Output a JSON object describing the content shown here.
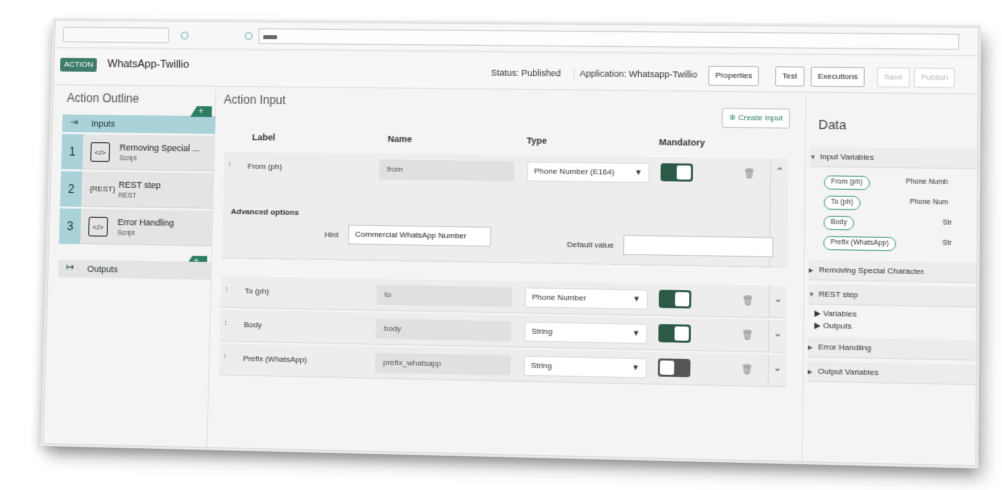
{
  "header": {
    "badge": "ACTION",
    "title": "WhatsApp-Twillio",
    "status": "Status: Published",
    "application": "Application: Whatsapp-Twillio",
    "buttons": {
      "properties": "Properties",
      "test": "Test",
      "executions": "Executions",
      "save": "Save",
      "publish": "Publish"
    }
  },
  "outline": {
    "title": "Action Outline",
    "inputs_label": "Inputs",
    "outputs_label": "Outputs",
    "plus": "+",
    "steps": [
      {
        "num": "1",
        "name": "Removing Special ...",
        "type": "Script",
        "icon": "script-icon"
      },
      {
        "num": "2",
        "name": "REST step",
        "type": "REST",
        "icon": "rest-icon",
        "icon_text": "{REST}"
      },
      {
        "num": "3",
        "name": "Error Handling",
        "type": "Script",
        "icon": "script-icon"
      }
    ]
  },
  "action_input": {
    "title": "Action Input",
    "create_label": "Create Input",
    "columns": {
      "label": "Label",
      "name": "Name",
      "type": "Type",
      "mandatory": "Mandatory"
    },
    "advanced": {
      "title": "Advanced options",
      "hint_label": "Hint",
      "hint_value": "Commercial WhatsApp Number",
      "default_label": "Default value",
      "default_value": ""
    },
    "rows": [
      {
        "label": "From (ph)",
        "name": "from",
        "type": "Phone Number (E164)",
        "mandatory": true,
        "expanded": true
      },
      {
        "label": "To (ph)",
        "name": "to",
        "type": "Phone Number",
        "mandatory": true,
        "expanded": false
      },
      {
        "label": "Body",
        "name": "body",
        "type": "String",
        "mandatory": true,
        "expanded": false
      },
      {
        "label": "Prefix (WhatsApp)",
        "name": "prefix_whatsapp",
        "type": "String",
        "mandatory": false,
        "expanded": false
      }
    ]
  },
  "data_panel": {
    "title": "Data",
    "input_variables": "Input Variables",
    "pills": [
      {
        "label": "From (ph)",
        "type": "Phone Numb"
      },
      {
        "label": "To (ph)",
        "type": "Phone Num"
      },
      {
        "label": "Body",
        "type": "Str"
      },
      {
        "label": "Prefix (WhatsApp)",
        "type": "Str"
      }
    ],
    "removing": "Removing Special Character.",
    "rest": "REST step",
    "variables": "Variables",
    "outputs": "Outputs",
    "error": "Error Handling",
    "output_variables": "Output Variables"
  },
  "colors": {
    "accent": "#2e7d64",
    "selected": "#a9d2d9",
    "toggle_on": "#2c5a46"
  }
}
